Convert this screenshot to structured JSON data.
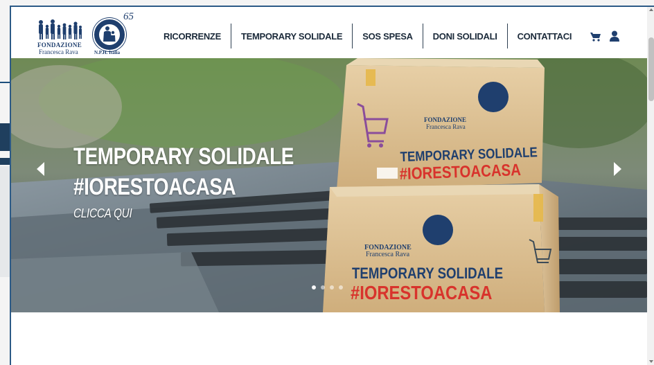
{
  "logo": {
    "org_line1": "FONDAZIONE",
    "org_line2": "Francesca Rava",
    "partner": "N.P.H. Italia",
    "anniversary": "65"
  },
  "nav": {
    "items": [
      {
        "label": "RICORRENZE"
      },
      {
        "label": "TEMPORARY SOLIDALE"
      },
      {
        "label": "SOS SPESA"
      },
      {
        "label": "DONI SOLIDALI"
      },
      {
        "label": "CONTATTACI"
      }
    ]
  },
  "icons": {
    "cart": "cart-icon",
    "user": "user-icon",
    "prev": "chevron-left-icon",
    "next": "chevron-right-icon"
  },
  "hero": {
    "title_line1": "TEMPORARY SOLIDALE",
    "title_line2": "#IORESTOACASA",
    "cta": "CLICCA QUI",
    "box_text_line1": "TEMPORARY SOLIDALE",
    "box_text_line2": "#IORESTOACASA",
    "slide_count": 4,
    "active_slide": 1
  },
  "colors": {
    "brand_navy": "#1f3f6e",
    "box_red": "#d8332c",
    "nav_text": "#1b2a3a"
  }
}
